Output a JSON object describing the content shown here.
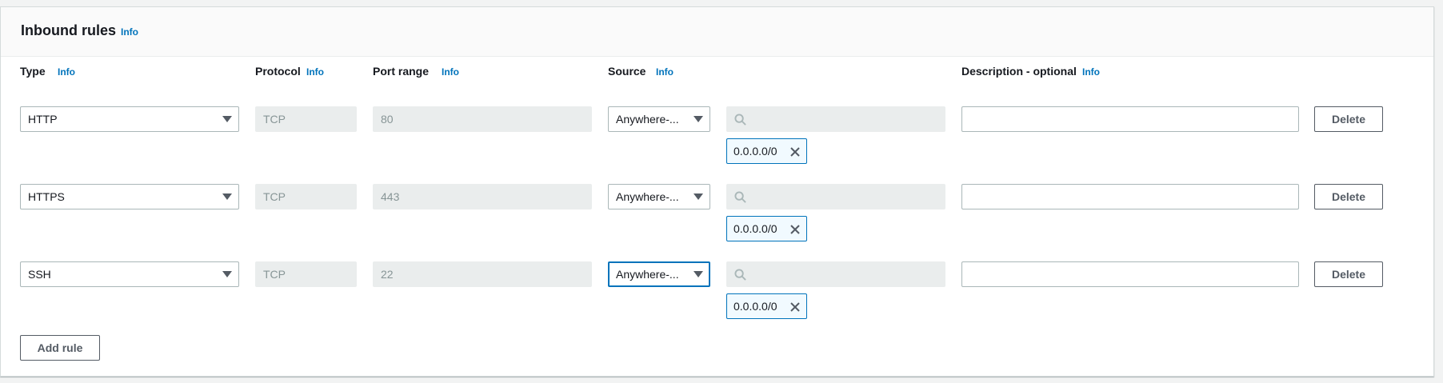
{
  "panel": {
    "title": "Inbound rules",
    "info_label": "Info"
  },
  "columns": {
    "type": {
      "label": "Type",
      "info": "Info"
    },
    "protocol": {
      "label": "Protocol",
      "info": "Info"
    },
    "port_range": {
      "label": "Port range",
      "info": "Info"
    },
    "source": {
      "label": "Source",
      "info": "Info"
    },
    "description": {
      "label": "Description - optional",
      "info": "Info"
    }
  },
  "rules": [
    {
      "type": "HTTP",
      "protocol": "TCP",
      "port_range": "80",
      "source": "Anywhere-...",
      "cidr": "0.0.0.0/0",
      "description": "",
      "delete_label": "Delete"
    },
    {
      "type": "HTTPS",
      "protocol": "TCP",
      "port_range": "443",
      "source": "Anywhere-...",
      "cidr": "0.0.0.0/0",
      "description": "",
      "delete_label": "Delete"
    },
    {
      "type": "SSH",
      "protocol": "TCP",
      "port_range": "22",
      "source": "Anywhere-...",
      "cidr": "0.0.0.0/0",
      "description": "",
      "delete_label": "Delete"
    }
  ],
  "add_rule_label": "Add rule",
  "icons": {
    "search": "search-icon",
    "remove": "close-icon",
    "dropdown": "caret-down-icon"
  },
  "colors": {
    "link": "#0073bb",
    "focus": "#0073bb",
    "token_bg": "#f1faff"
  }
}
